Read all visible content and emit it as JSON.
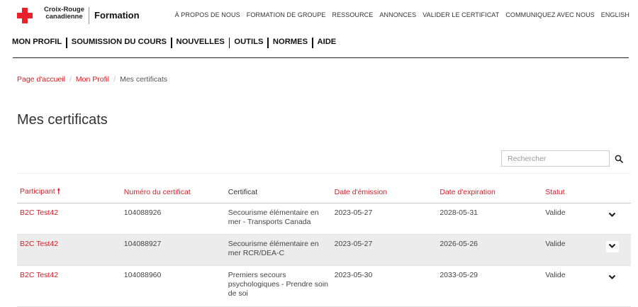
{
  "brand": {
    "logo_line1": "Croix-Rouge",
    "logo_line2": "canadienne",
    "section": "Formation",
    "accent": "#e8212b"
  },
  "top_nav": [
    "À PROPOS DE NOUS",
    "FORMATION DE GROUPE",
    "RESSOURCE",
    "ANNONCES",
    "VALIDER LE CERTIFICAT",
    "COMMUNIQUEZ AVEC NOUS",
    "ENGLISH"
  ],
  "secondary_nav": [
    "MON PROFIL",
    "SOUMISSION DU COURS",
    "NOUVELLES",
    "OUTILS",
    "NORMES",
    "AIDE"
  ],
  "breadcrumb": {
    "home": "Page d'accueil",
    "profile": "Mon Profil",
    "current": "Mes certificats",
    "separator": "/"
  },
  "page_title": "Mes certificats",
  "search": {
    "placeholder": "Rechercher",
    "icon": "search-icon"
  },
  "table": {
    "headers": {
      "participant": "Participant",
      "sort_indicator": "🠕",
      "certificate_number": "Numéro du certificat",
      "certificate": "Certificat",
      "issue_date": "Date d'émission",
      "expiry_date": "Date d'expiration",
      "status": "Statut"
    },
    "rows": [
      {
        "participant": "B2C Test42",
        "number": "104088926",
        "certificate": "Secourisme élémentaire en mer - Transports Canada",
        "issued": "2023-05-27",
        "expires": "2028-05-31",
        "status": "Valide"
      },
      {
        "participant": "B2C Test42",
        "number": "104088927",
        "certificate": "Secourisme élémentaire en mer RCR/DEA-C",
        "issued": "2023-05-27",
        "expires": "2026-05-26",
        "status": "Valide"
      },
      {
        "participant": "B2C Test42",
        "number": "104088960",
        "certificate": "Premiers secours psychologiques - Prendre soin de soi",
        "issued": "2023-05-30",
        "expires": "2033-05-29",
        "status": "Valide"
      }
    ]
  }
}
